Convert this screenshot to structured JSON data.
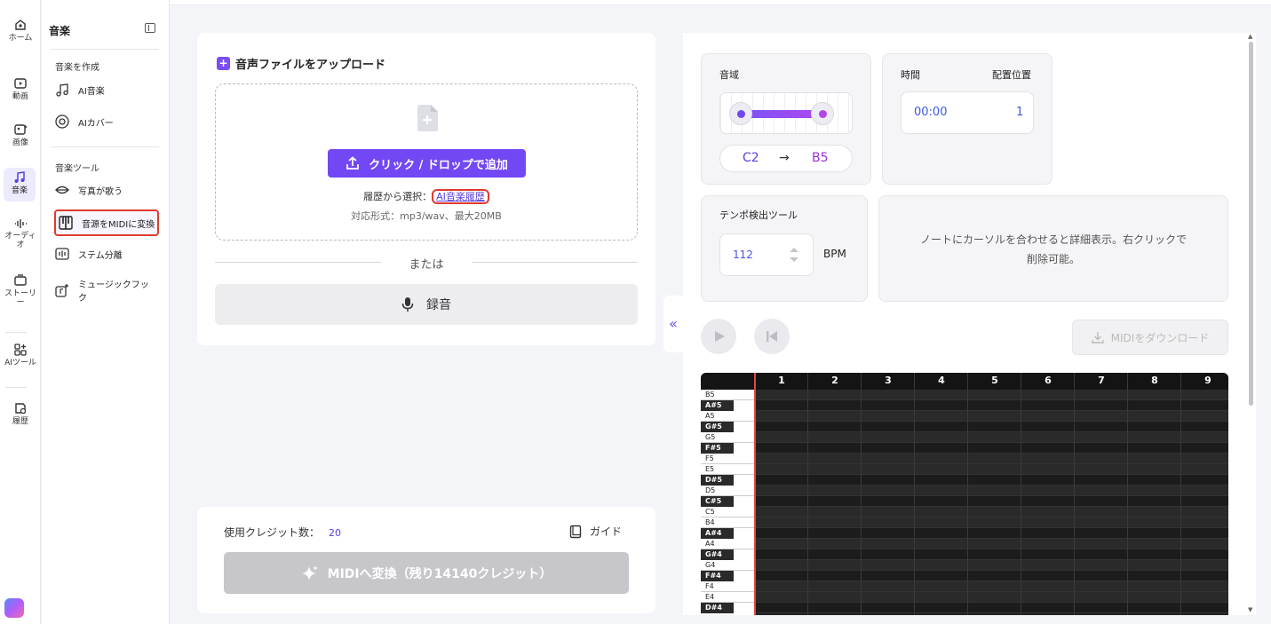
{
  "rail": [
    {
      "label": "ホーム",
      "icon": "home-icon"
    },
    {
      "label": "動画",
      "icon": "video-icon"
    },
    {
      "label": "画像",
      "icon": "image-icon"
    },
    {
      "label": "音楽",
      "icon": "music-icon",
      "active": true
    },
    {
      "label": "オーディオ",
      "icon": "audio-icon"
    },
    {
      "label": "ストーリー",
      "icon": "story-icon"
    },
    {
      "label": "AIツール",
      "icon": "ai-tools-icon"
    },
    {
      "label": "履歴",
      "icon": "history-icon"
    }
  ],
  "sidebar": {
    "title": "音楽",
    "section_create": "音楽を作成",
    "create_items": [
      {
        "label": "AI音楽",
        "icon": "music-note-icon"
      },
      {
        "label": "AIカバー",
        "icon": "disc-icon"
      }
    ],
    "section_tools": "音楽ツール",
    "tool_items": [
      {
        "label": "写真が歌う",
        "icon": "lips-icon"
      },
      {
        "label": "音源をMIDIに変換",
        "icon": "piano-icon"
      },
      {
        "label": "ステム分離",
        "icon": "waveform-icon"
      },
      {
        "label": "ミュージックフック",
        "icon": "hook-icon"
      }
    ]
  },
  "upload": {
    "title": "音声ファイルをアップロード",
    "button": "クリック / ドロップで追加",
    "history_prefix": "履歴から選択：",
    "history_link": "AI音楽履歴",
    "formats": "対応形式：mp3/wav、最大20MB",
    "or": "または",
    "record": "録音"
  },
  "bottom": {
    "credits_label": "使用クレジット数：",
    "credits_value": "20",
    "guide": "ガイド",
    "convert": "MIDIへ変換（残り14140クレジット）"
  },
  "range": {
    "label": "音域",
    "low": "C2",
    "arrow": "→",
    "high": "B5"
  },
  "time": {
    "label": "時間",
    "position_label": "配置位置",
    "value": "00:00",
    "position": "1"
  },
  "tempo": {
    "label": "テンポ検出ツール",
    "value": "112",
    "unit": "BPM"
  },
  "info": {
    "line1": "ノートにカーソルを合わせると詳細表示。右クリックで",
    "line2": "削除可能。"
  },
  "download": "MIDIをダウンロード",
  "roll": {
    "columns": [
      "1",
      "2",
      "3",
      "4",
      "5",
      "6",
      "7",
      "8",
      "9"
    ],
    "keys": [
      "B5",
      "A#5",
      "A5",
      "G#5",
      "G5",
      "F#5",
      "F5",
      "E5",
      "D#5",
      "D5",
      "C#5",
      "C5",
      "B4",
      "A#4",
      "A4",
      "G#4",
      "G4",
      "F#4",
      "F4",
      "E4",
      "D#4"
    ]
  },
  "colors": {
    "accent": "#7148f3",
    "highlight": "#e03a2f"
  }
}
